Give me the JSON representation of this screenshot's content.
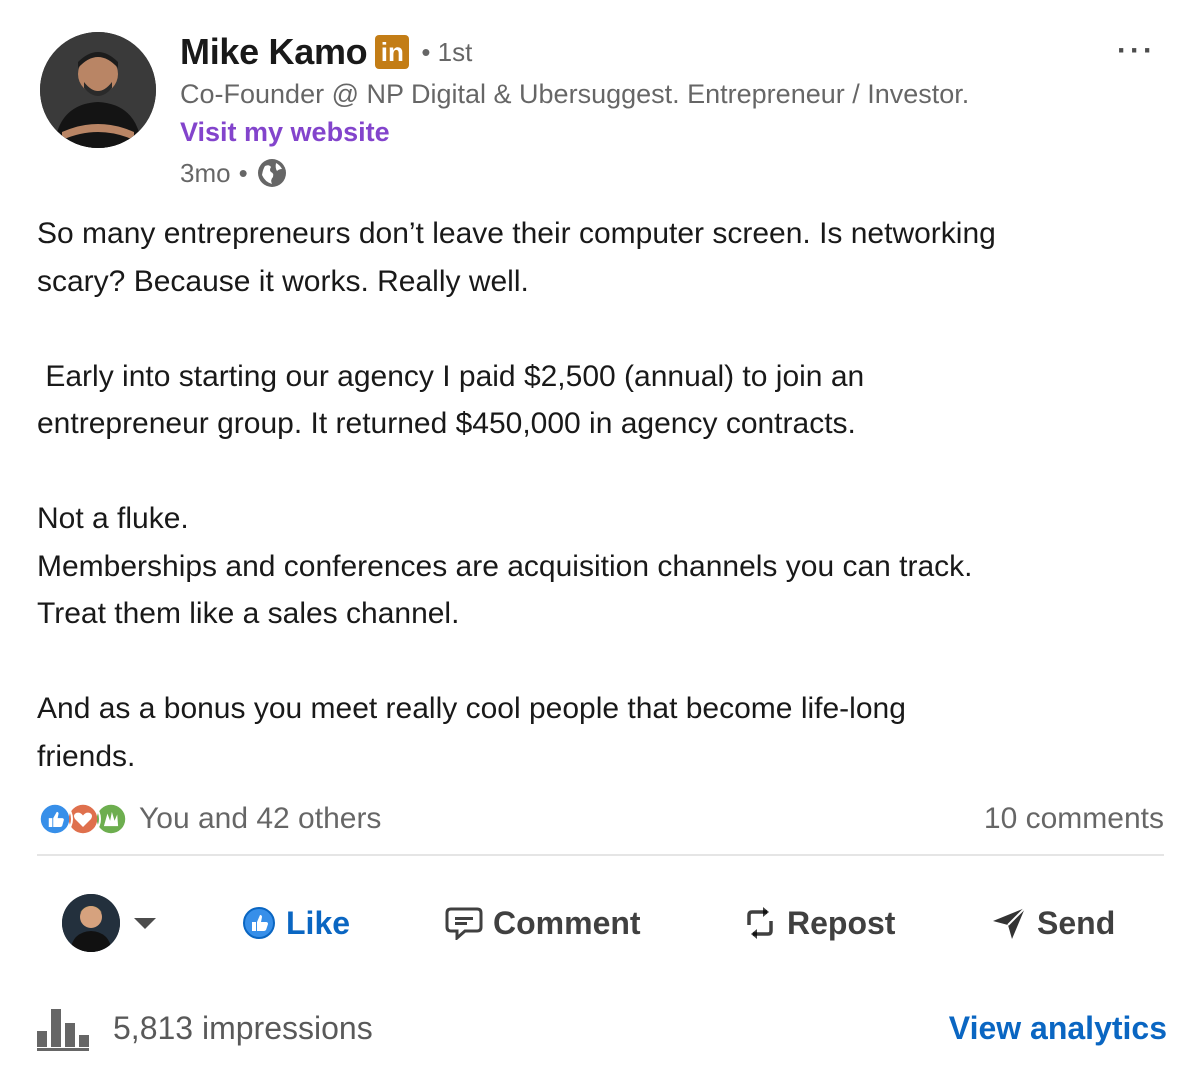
{
  "author": {
    "name": "Mike Kamo",
    "badge": "in",
    "degree": "• 1st",
    "headline": "Co-Founder @ NP Digital & Ubersuggest. Entrepreneur / Investor.",
    "website_label": "Visit my website",
    "time": "3mo",
    "time_separator": "•",
    "visibility_icon": "globe-icon"
  },
  "more_label": "···",
  "post": {
    "paragraphs": [
      [
        "So many entrepreneurs don’t leave their computer screen. Is networking",
        "scary? Because it works. Really well."
      ],
      [
        " Early into starting our agency I paid $2,500 (annual) to join an",
        "entrepreneur group. It returned $450,000 in agency contracts."
      ],
      [
        "Not a fluke.",
        "Memberships and conferences are acquisition channels you can track.",
        "Treat them like a sales channel."
      ],
      [
        "And as a bonus you meet really cool people that become life-long",
        "friends."
      ]
    ]
  },
  "social": {
    "reactions_label": "You and 42 others",
    "comments_label": "10 comments",
    "reaction_icons": [
      "like-reaction-icon",
      "love-reaction-icon",
      "celebrate-reaction-icon"
    ]
  },
  "actions": {
    "like": "Like",
    "comment": "Comment",
    "repost": "Repost",
    "send": "Send"
  },
  "footer": {
    "impressions": "5,813 impressions",
    "analytics": "View analytics"
  },
  "colors": {
    "link_blue": "#0a66c2",
    "website_purple": "#8344cc",
    "premium_gold": "#c37d16"
  }
}
